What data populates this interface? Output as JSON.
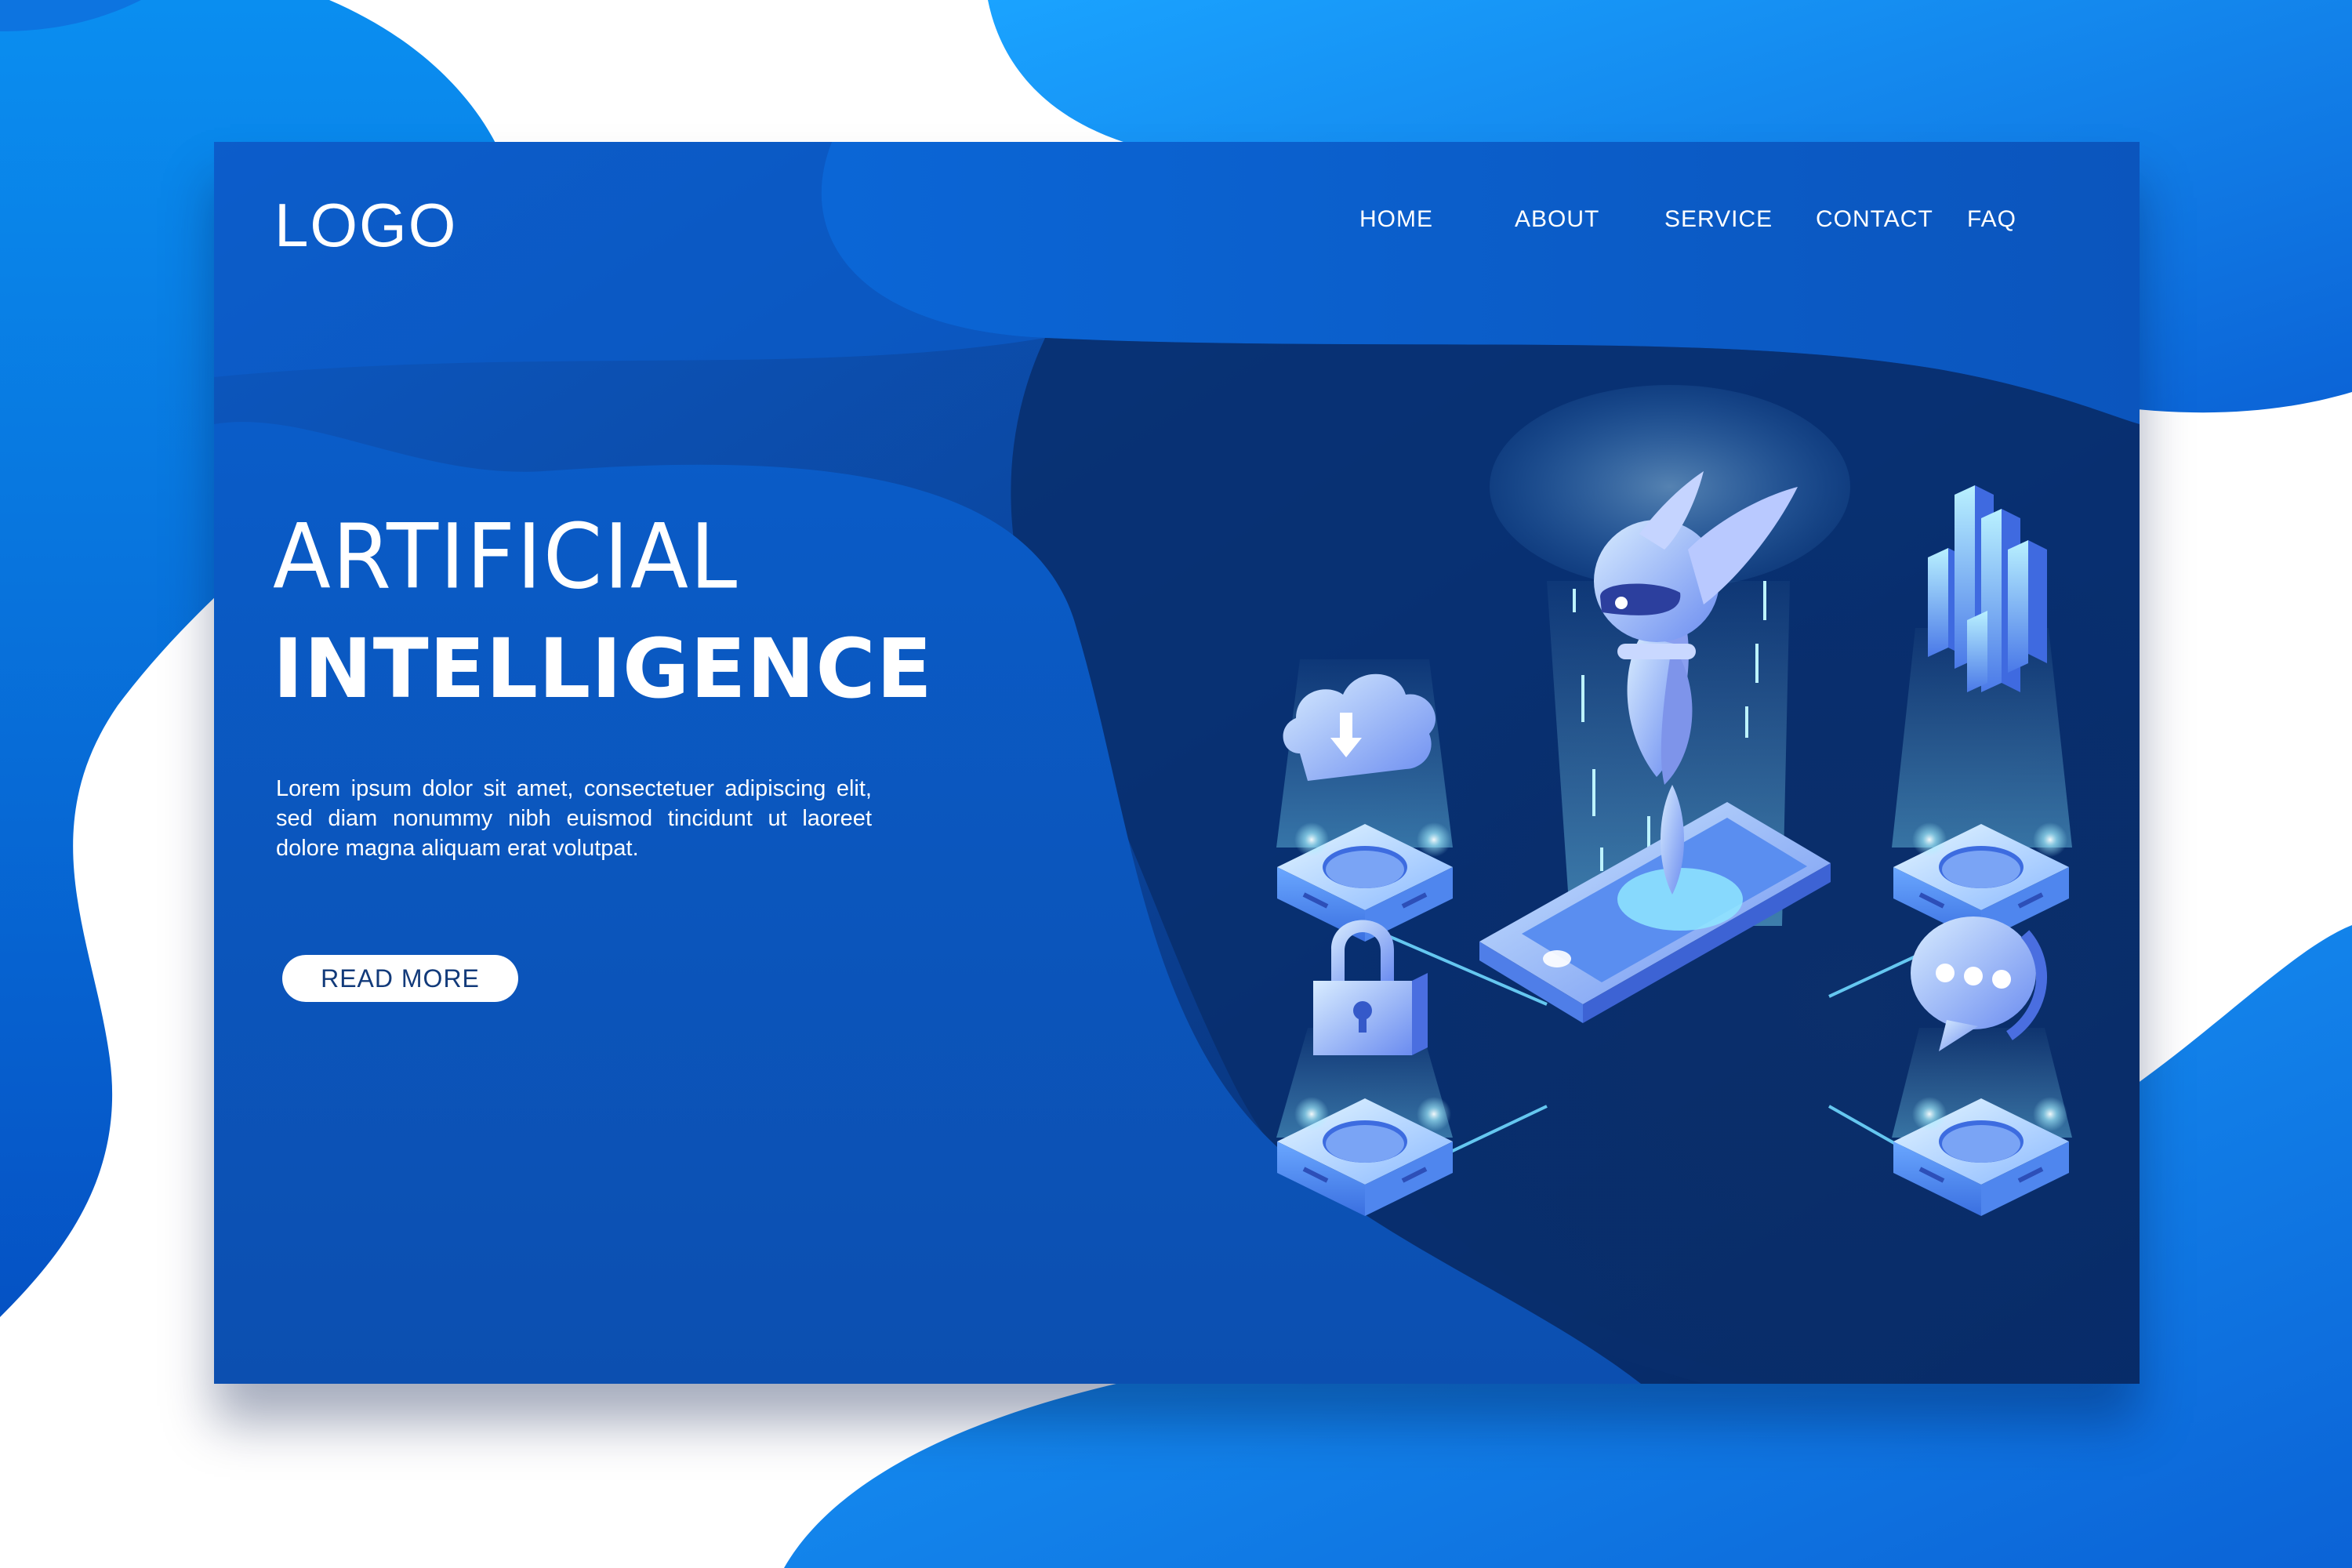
{
  "header": {
    "logo": "LOGO",
    "nav": [
      {
        "label": "HOME"
      },
      {
        "label": "ABOUT"
      },
      {
        "label": "SERVICE"
      },
      {
        "label": "CONTACT"
      },
      {
        "label": "FAQ"
      }
    ]
  },
  "hero": {
    "title_light": "ARTIFICIAL",
    "title_bold": "INTELLIGENCE",
    "body": "Lorem ipsum dolor sit amet, consectetuer adipiscing elit, sed diam nonummy nibh euismod tincidunt ut laoreet dolore magna aliquam erat volutpat.",
    "cta": "READ MORE"
  },
  "theme": {
    "page_background": "#ffffff",
    "card_top": "#0b55b6",
    "card_deep": "#0a2c63",
    "accent": "#1596f5",
    "glow": "#8fe6ff"
  },
  "illustration": {
    "icons": [
      "robot-icon",
      "smartphone-icon",
      "cloud-download-icon",
      "bar-chart-icon",
      "padlock-icon",
      "chat-bubble-icon"
    ]
  }
}
